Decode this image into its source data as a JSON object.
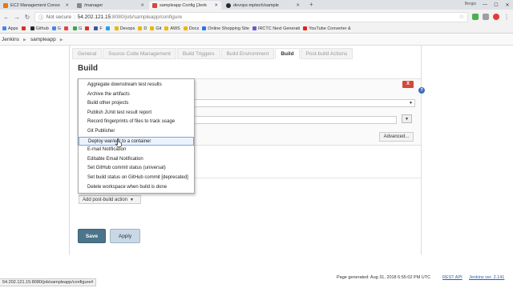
{
  "browser": {
    "tabs": [
      {
        "label": "EC2 Management Conso",
        "color": "#e47911"
      },
      {
        "label": "/manager",
        "color": "#777777"
      },
      {
        "label": "sampleapp Config [Jenk",
        "color": "#d24939"
      },
      {
        "label": "devops-mptech/sample",
        "color": "#24292e"
      }
    ],
    "new_tab": "+",
    "user": "Bergis",
    "address": {
      "not_secure": "Not secure",
      "host": "54.202.121.15",
      "path": ":8080/job/sampleapp/configure"
    },
    "bookmarks": [
      {
        "label": "Apps",
        "color": "#4285f4"
      },
      {
        "label": "",
        "color": "#d93025"
      },
      {
        "label": "Github",
        "color": "#24292e"
      },
      {
        "label": "G",
        "color": "#4285f4"
      },
      {
        "label": "",
        "color": "#ea4335"
      },
      {
        "label": "G",
        "color": "#34a853"
      },
      {
        "label": "",
        "color": "#d93025"
      },
      {
        "label": "F",
        "color": "#3b5998"
      },
      {
        "label": "",
        "color": "#1da1f2"
      },
      {
        "label": "Devops",
        "color": "#f4b400"
      },
      {
        "label": "D",
        "color": "#f4b400"
      },
      {
        "label": "Git",
        "color": "#f4b400"
      },
      {
        "label": "AWS",
        "color": "#f4b400"
      },
      {
        "label": "Docs",
        "color": "#f4b400"
      },
      {
        "label": "Online Shopping Site",
        "color": "#2874f0"
      },
      {
        "label": "IRCTC Next Generati",
        "color": "#6a5acd"
      },
      {
        "label": "YouTube Converter &",
        "color": "#e62117"
      }
    ]
  },
  "breadcrumbs": [
    "Jenkins",
    "sampleapp"
  ],
  "config_tabs": [
    "General",
    "Source Code Management",
    "Build Triggers",
    "Build Environment",
    "Build",
    "Post-build Actions"
  ],
  "active_tab": "Build",
  "section_title": "Build",
  "delete_label": "X",
  "help_label": "?",
  "advanced_label": "Advanced...",
  "add_post_build_label": "Add post-build action",
  "save_label": "Save",
  "apply_label": "Apply",
  "menu_items": [
    "Aggregate downstream test results",
    "Archive the artifacts",
    "Build other projects",
    "Publish JUnit test result report",
    "Record fingerprints of files to track usage",
    "Git Publisher",
    "Deploy war/ear to a container",
    "E-mail Notification",
    "Editable Email Notification",
    "Set GitHub commit status (universal)",
    "Set build status on GitHub commit [deprecated]",
    "Delete workspace when build is done"
  ],
  "highlighted_index": 6,
  "footer": {
    "generated": "Page generated: Aug 31, 2018 6:55:02 PM UTC",
    "rest_api": "REST API",
    "version": "Jenkins ver. 2.141"
  },
  "status_url": "54.202.121.15:8080/job/sampleapp/configure#"
}
